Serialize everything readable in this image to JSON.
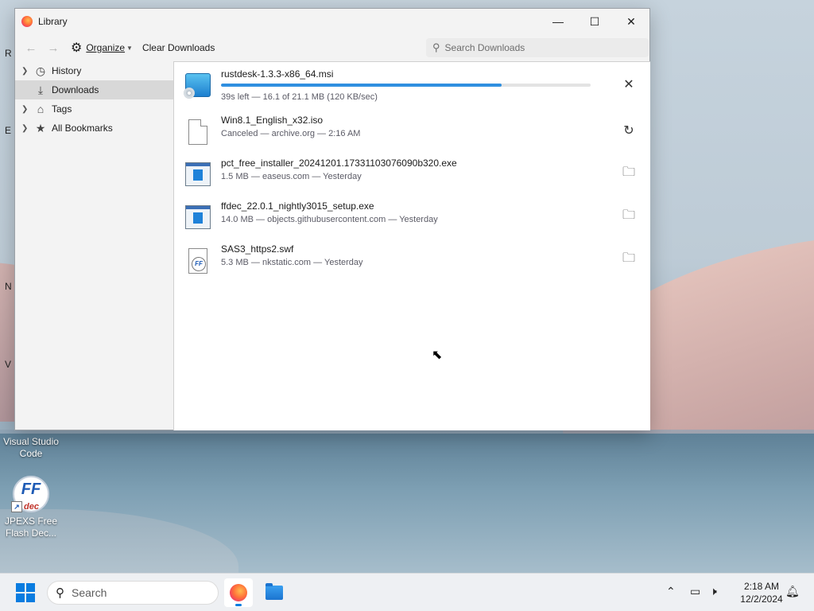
{
  "desktop": {
    "icons": [
      {
        "label": "Visual Studio Code"
      },
      {
        "label": "JPEXS Free Flash Dec..."
      }
    ],
    "edge_fragments": [
      "R",
      "E",
      "N",
      "V"
    ]
  },
  "window": {
    "title": "Library",
    "controls": {
      "minimize": "—",
      "maximize": "☐",
      "close": "✕"
    }
  },
  "toolbar": {
    "organize_label": "Organize",
    "clear_label": "Clear Downloads",
    "search_placeholder": "Search Downloads"
  },
  "sidebar": {
    "items": [
      {
        "label": "History",
        "icon": "clock-icon",
        "expandable": true
      },
      {
        "label": "Downloads",
        "icon": "download-icon",
        "expandable": false,
        "active": true
      },
      {
        "label": "Tags",
        "icon": "tag-icon",
        "expandable": true
      },
      {
        "label": "All Bookmarks",
        "icon": "star-icon",
        "expandable": true
      }
    ]
  },
  "downloads": [
    {
      "name": "rustdesk-1.3.3-x86_64.msi",
      "status": "39s left — 16.1 of 21.1 MB (120 KB/sec)",
      "progress": 0.76,
      "action": "cancel",
      "icon": "msi-icon"
    },
    {
      "name": "Win8.1_English_x32.iso",
      "status": "Canceled — archive.org — 2:16 AM",
      "action": "retry",
      "icon": "file-icon"
    },
    {
      "name": "pct_free_installer_20241201.17331103076090b320.exe",
      "status": "1.5 MB — easeus.com — Yesterday",
      "action": "show-folder",
      "icon": "exe-icon"
    },
    {
      "name": "ffdec_22.0.1_nightly3015_setup.exe",
      "status": "14.0 MB — objects.githubusercontent.com — Yesterday",
      "action": "show-folder",
      "icon": "exe-icon"
    },
    {
      "name": "SAS3_https2.swf",
      "status": "5.3 MB — nkstatic.com — Yesterday",
      "action": "show-folder",
      "icon": "swf-icon"
    }
  ],
  "taskbar": {
    "search_placeholder": "Search",
    "time": "2:18 AM",
    "date": "12/2/2024"
  },
  "colors": {
    "accent": "#0a7ce0",
    "progress": "#2f8fe0"
  }
}
